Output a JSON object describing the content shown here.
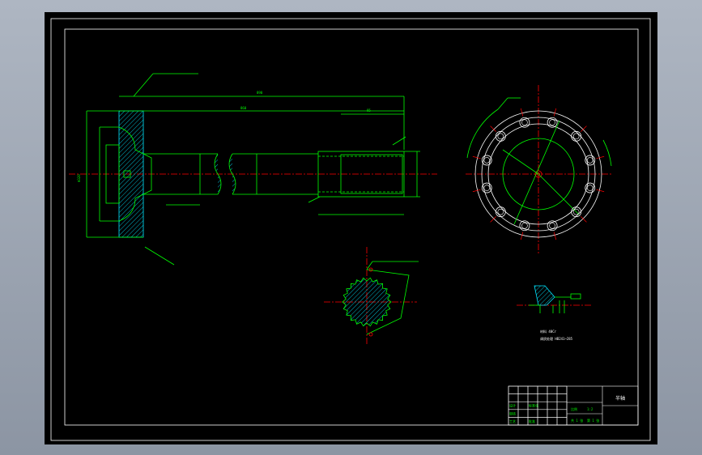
{
  "colors": {
    "background": "#000000",
    "frame": "#ffffff",
    "geometry": "#00ff00",
    "centerline": "#ff0000",
    "hatch": "#00e5ff",
    "annotation": "#00ff00"
  },
  "title_block": {
    "title": "半轴",
    "rows": [
      [
        "",
        "",
        "",
        "",
        "",
        ""
      ],
      [
        "",
        "",
        "",
        "",
        "",
        ""
      ],
      [
        "设计",
        "",
        "标准化",
        "",
        "",
        ""
      ],
      [
        "审核",
        "",
        "",
        "",
        "",
        ""
      ],
      [
        "工艺",
        "",
        "批准",
        "",
        "",
        ""
      ]
    ],
    "scale_label": "比例",
    "scale_value": "1:2",
    "sheet_a": "共 1 张",
    "sheet_b": "第 1 张"
  },
  "notes": {
    "tech_1": "材料 40Cr",
    "tech_2": "调质处理 HB241~285"
  },
  "dimensions": {
    "overall_length": "890",
    "shaft_length": "860",
    "spline_length": "95",
    "flange_dia": "Φ320",
    "bolt_circle": "Φ280"
  }
}
